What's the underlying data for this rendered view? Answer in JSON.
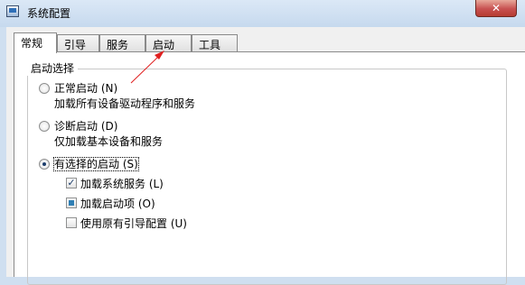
{
  "window": {
    "title": "系统配置",
    "close_glyph": "✕"
  },
  "tabs": [
    {
      "label": "常规",
      "active": true
    },
    {
      "label": "引导",
      "active": false
    },
    {
      "label": "服务",
      "active": false
    },
    {
      "label": "启动",
      "active": false
    },
    {
      "label": "工具",
      "active": false
    }
  ],
  "startup_selection": {
    "legend": "启动选择",
    "normal": {
      "label": "正常启动 (N)",
      "description": "加载所有设备驱动程序和服务",
      "checked": false
    },
    "diagnostic": {
      "label": "诊断启动 (D)",
      "description": "仅加载基本设备和服务",
      "checked": false
    },
    "selective": {
      "label": "有选择的启动 (S)",
      "checked": true,
      "options": [
        {
          "label": "加载系统服务 (L)",
          "state": "checked",
          "check_glyph": "✓"
        },
        {
          "label": "加载启动项 (O)",
          "state": "indeterminate",
          "check_glyph": ""
        },
        {
          "label": "使用原有引导配置 (U)",
          "state": "unchecked",
          "check_glyph": ""
        }
      ]
    }
  },
  "colors": {
    "annotation_arrow": "#e02020",
    "titlebar": "#c6d9ee",
    "close_button": "#c75050"
  }
}
